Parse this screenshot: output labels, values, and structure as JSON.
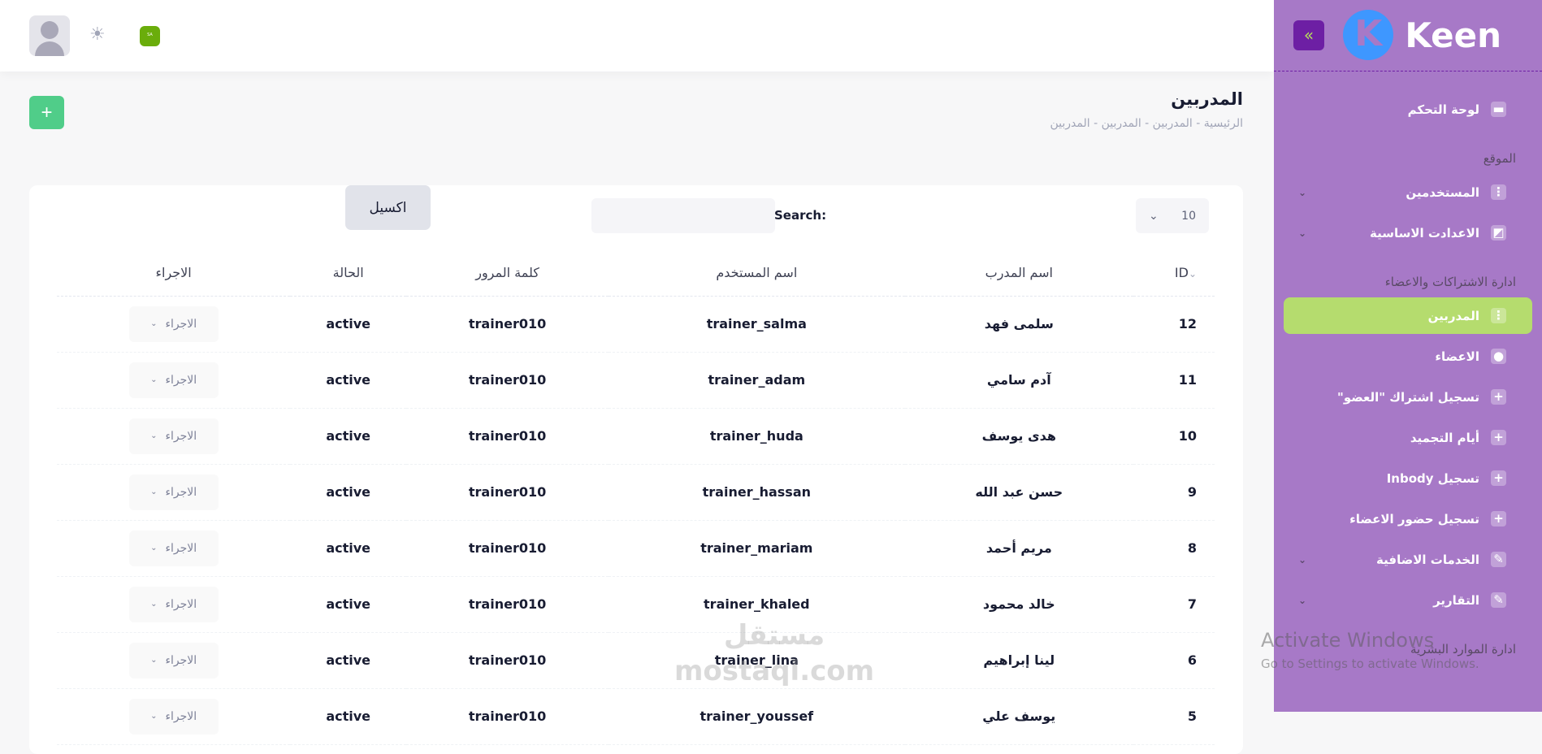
{
  "header": {
    "language_flag": "SA"
  },
  "page": {
    "title": "المدربين",
    "breadcrumbs": "الرئيسية - المدربين - المدربين - المدربين",
    "add_label": "+"
  },
  "toolbar": {
    "page_size": "10",
    "search_label": "Search:",
    "search_placeholder": "",
    "excel_label": "اكسيل"
  },
  "table": {
    "columns": [
      "ID",
      "اسم المدرب",
      "اسم المستخدم",
      "كلمة المرور",
      "الحالة",
      "الاجراء"
    ],
    "rows": [
      {
        "id": "12",
        "name": "سلمى فهد",
        "username": "trainer_salma",
        "password": "trainer010",
        "status": "active",
        "action": "الاجراء"
      },
      {
        "id": "11",
        "name": "آدم سامي",
        "username": "trainer_adam",
        "password": "trainer010",
        "status": "active",
        "action": "الاجراء"
      },
      {
        "id": "10",
        "name": "هدى يوسف",
        "username": "trainer_huda",
        "password": "trainer010",
        "status": "active",
        "action": "الاجراء"
      },
      {
        "id": "9",
        "name": "حسن عبد الله",
        "username": "trainer_hassan",
        "password": "trainer010",
        "status": "active",
        "action": "الاجراء"
      },
      {
        "id": "8",
        "name": "مريم أحمد",
        "username": "trainer_mariam",
        "password": "trainer010",
        "status": "active",
        "action": "الاجراء"
      },
      {
        "id": "7",
        "name": "خالد محمود",
        "username": "trainer_khaled",
        "password": "trainer010",
        "status": "active",
        "action": "الاجراء"
      },
      {
        "id": "6",
        "name": "لينا إبراهيم",
        "username": "trainer_lina",
        "password": "trainer010",
        "status": "active",
        "action": "الاجراء"
      },
      {
        "id": "5",
        "name": "يوسف علي",
        "username": "trainer_youssef",
        "password": "trainer010",
        "status": "active",
        "action": "الاجراء"
      }
    ]
  },
  "sidebar": {
    "brand": "Keen",
    "logo_letter": "K",
    "items": [
      {
        "type": "item",
        "label": "لوحة التحكم",
        "icon": "▬"
      },
      {
        "type": "section",
        "label": "الموقع"
      },
      {
        "type": "item",
        "label": "المستخدمين",
        "icon": "⋮",
        "chevron": true
      },
      {
        "type": "item",
        "label": "الاعدادت الاساسية",
        "icon": "◩",
        "chevron": true
      },
      {
        "type": "section",
        "label": "ادارة الاشتراكات والاعضاء"
      },
      {
        "type": "item",
        "label": "المدربين",
        "icon": "⋮",
        "active": true
      },
      {
        "type": "item",
        "label": "الاعضاء",
        "icon": "●"
      },
      {
        "type": "item",
        "label": "تسجيل اشتراك \"العضو\"",
        "icon": "+"
      },
      {
        "type": "item",
        "label": "أيام التجميد",
        "icon": "+"
      },
      {
        "type": "item",
        "label": "تسجيل Inbody",
        "icon": "+"
      },
      {
        "type": "item",
        "label": "تسجيل حضور الاعضاء",
        "icon": "+"
      },
      {
        "type": "item",
        "label": "الخدمات الاضافية",
        "icon": "✎",
        "chevron": true
      },
      {
        "type": "item",
        "label": "التقارير",
        "icon": "✎",
        "chevron": true
      },
      {
        "type": "section",
        "label": "ادارة الموارد البشرية"
      }
    ]
  },
  "overlay": {
    "activate_title": "Activate Windows",
    "activate_sub": "Go to Settings to activate Windows.",
    "watermark": "مستقل",
    "watermark_url": "mostaql.com"
  }
}
